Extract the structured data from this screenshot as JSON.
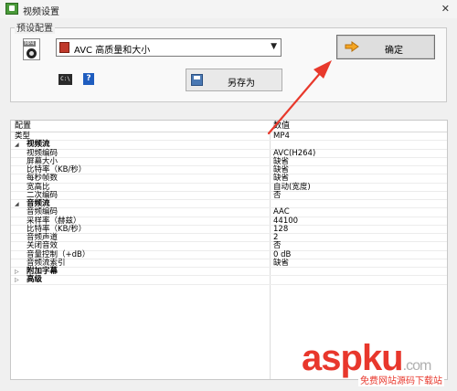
{
  "window": {
    "title": "视频设置",
    "close_glyph": "✕"
  },
  "preset": {
    "group_title": "预设配置",
    "icon": "mp4-file-icon",
    "mp4_tag": "MP4",
    "selected": "AVC 高质量和大小",
    "ok_label": "确定",
    "cmd_icon_text": "C:\\",
    "help_icon_text": "?",
    "save_as_label": "另存为"
  },
  "grid": {
    "headers": {
      "name": "配置",
      "value": "数值"
    },
    "rows": [
      {
        "name": "类型",
        "value": "MP4",
        "kind": "plain"
      },
      {
        "name": "视频流",
        "value": "",
        "kind": "group",
        "expander": "◢"
      },
      {
        "name": "视频编码",
        "value": "AVC(H264)",
        "kind": "child"
      },
      {
        "name": "屏幕大小",
        "value": "缺省",
        "kind": "child"
      },
      {
        "name": "比特率（KB/秒）",
        "value": "缺省",
        "kind": "child"
      },
      {
        "name": "每秒帧数",
        "value": "缺省",
        "kind": "child"
      },
      {
        "name": "宽高比",
        "value": "自动(宽度)",
        "kind": "child"
      },
      {
        "name": "二次编码",
        "value": "否",
        "kind": "child"
      },
      {
        "name": "音频流",
        "value": "",
        "kind": "group",
        "expander": "◢"
      },
      {
        "name": "音频编码",
        "value": "AAC",
        "kind": "child"
      },
      {
        "name": "采样率（赫兹）",
        "value": "44100",
        "kind": "child"
      },
      {
        "name": "比特率（KB/秒）",
        "value": "128",
        "kind": "child"
      },
      {
        "name": "音频声道",
        "value": "2",
        "kind": "child"
      },
      {
        "name": "关闭音效",
        "value": "否",
        "kind": "child"
      },
      {
        "name": "音量控制（+dB）",
        "value": "0 dB",
        "kind": "child"
      },
      {
        "name": "音频流索引",
        "value": "缺省",
        "kind": "child"
      },
      {
        "name": "附加字幕",
        "value": "",
        "kind": "group",
        "expander": "▷"
      },
      {
        "name": "高级",
        "value": "",
        "kind": "group",
        "expander": "▷"
      }
    ]
  },
  "annotation": {
    "arrow_color": "#e8392c"
  },
  "watermark": {
    "brand_a": "asp",
    "brand_b": "ku",
    "brand_c": ".com",
    "sub": "免费网站源码下载站"
  },
  "colors": {
    "accent": "#e8372c",
    "ok_button_bg": "#dedede"
  }
}
